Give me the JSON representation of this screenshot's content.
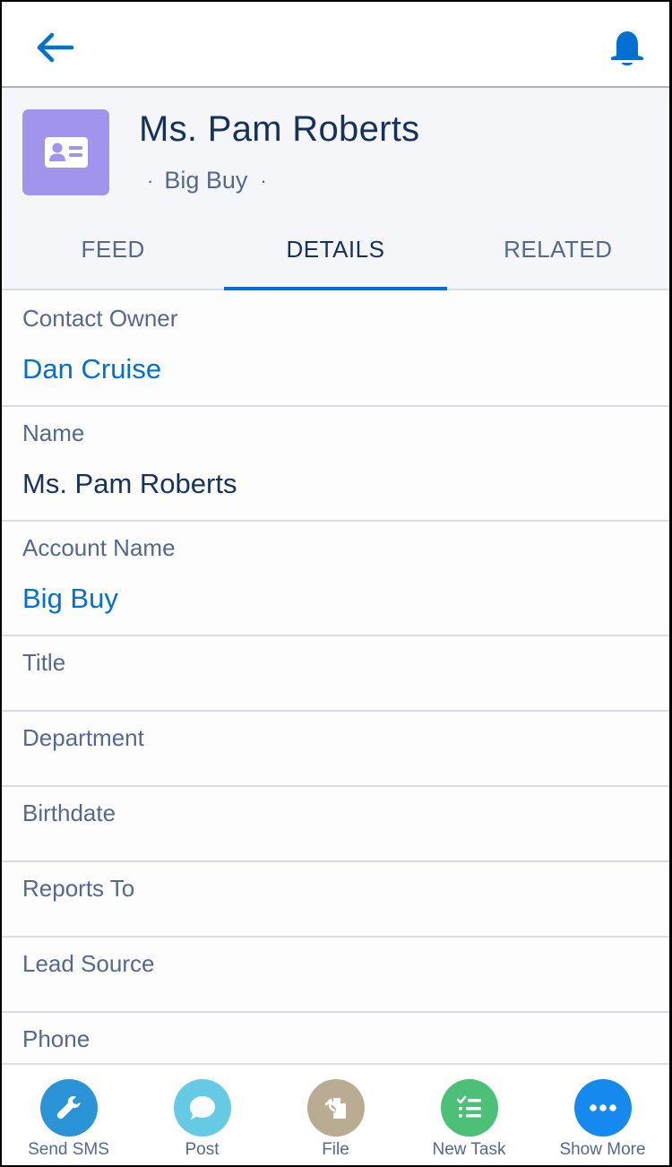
{
  "topnav": {
    "back_icon": "arrow-left-icon",
    "notifications_icon": "bell-icon",
    "accent_color": "#0070d2"
  },
  "record": {
    "icon": "contact-card-icon",
    "icon_color": "#a094ed",
    "title": "Ms. Pam Roberts",
    "subtitle_separator": "·",
    "subtitle": "Big Buy"
  },
  "tabs": [
    {
      "label": "FEED",
      "active": false
    },
    {
      "label": "DETAILS",
      "active": true
    },
    {
      "label": "RELATED",
      "active": false
    }
  ],
  "fields": [
    {
      "label": "Contact Owner",
      "value": "Dan Cruise",
      "link": true
    },
    {
      "label": "Name",
      "value": "Ms. Pam Roberts",
      "link": false
    },
    {
      "label": "Account Name",
      "value": "Big Buy",
      "link": true
    },
    {
      "label": "Title",
      "value": ""
    },
    {
      "label": "Department",
      "value": ""
    },
    {
      "label": "Birthdate",
      "value": ""
    },
    {
      "label": "Reports To",
      "value": ""
    },
    {
      "label": "Lead Source",
      "value": ""
    },
    {
      "label": "Phone",
      "value": ""
    }
  ],
  "actions": [
    {
      "label": "Send SMS",
      "icon": "wrench-icon",
      "color": "#2a94d6"
    },
    {
      "label": "Post",
      "icon": "chat-bubble-icon",
      "color": "#65cae4"
    },
    {
      "label": "File",
      "icon": "file-upload-icon",
      "color": "#baac93"
    },
    {
      "label": "New Task",
      "icon": "task-list-icon",
      "color": "#4bc076"
    },
    {
      "label": "Show More",
      "icon": "more-dots-icon",
      "color": "#1589ee"
    }
  ]
}
